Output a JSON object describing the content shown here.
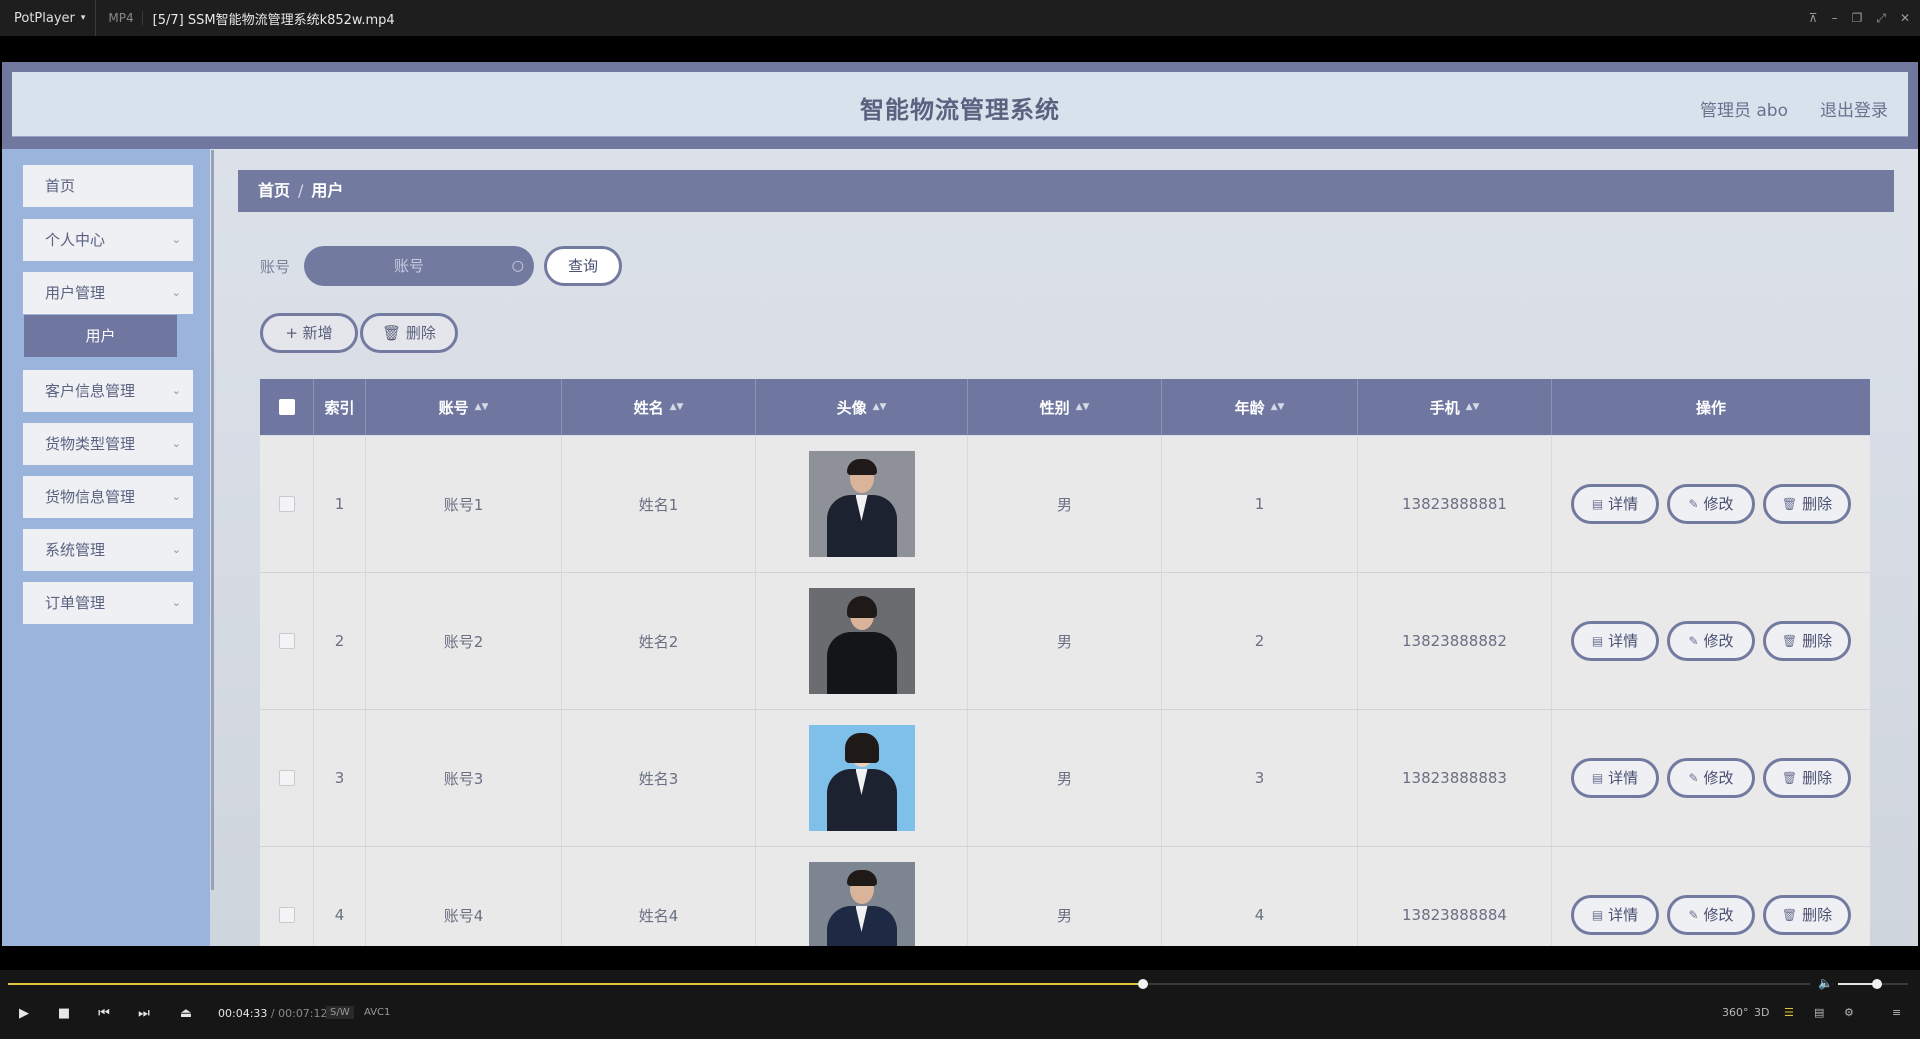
{
  "player": {
    "app_name": "PotPlayer",
    "format": "MP4",
    "file_title": "[5/7] SSM智能物流管理系统k852w.mp4",
    "current_time": "00:04:33",
    "total_time": "00:07:12",
    "badge_sw": "S/W",
    "badge_codec": "AVC1",
    "label_360": "360°",
    "label_3d": "3D",
    "progress_fraction": 0.63,
    "volume_fraction": 0.55,
    "accent_color": "#e2c43a"
  },
  "app": {
    "title": "智能物流管理系统",
    "admin_label": "管理员 abo",
    "logout_label": "退出登录",
    "primary_color": "#6f77a0",
    "sidebar_color": "#9bb4dc"
  },
  "sidebar": {
    "items": [
      {
        "label": "首页",
        "has_children": false
      },
      {
        "label": "个人中心",
        "has_children": true
      },
      {
        "label": "用户管理",
        "has_children": true
      },
      {
        "label": "客户信息管理",
        "has_children": true
      },
      {
        "label": "货物类型管理",
        "has_children": true
      },
      {
        "label": "货物信息管理",
        "has_children": true
      },
      {
        "label": "系统管理",
        "has_children": true
      },
      {
        "label": "订单管理",
        "has_children": true
      }
    ],
    "active_sub": "用户"
  },
  "breadcrumb": {
    "home": "首页",
    "separator": "/",
    "current": "用户"
  },
  "search": {
    "label": "账号",
    "placeholder": "账号",
    "value": "",
    "query_label": "查询"
  },
  "actions": {
    "add_label": "新增",
    "delete_label": "删除"
  },
  "table": {
    "columns": [
      "索引",
      "账号",
      "姓名",
      "头像",
      "性别",
      "年龄",
      "手机",
      "操作"
    ],
    "rows": [
      {
        "index": "1",
        "account": "账号1",
        "name": "姓名1",
        "gender": "男",
        "age": "1",
        "phone": "13823888881",
        "photo": "man-grey-background"
      },
      {
        "index": "2",
        "account": "账号2",
        "name": "姓名2",
        "gender": "男",
        "age": "2",
        "phone": "13823888882",
        "photo": "woman-grey-background"
      },
      {
        "index": "3",
        "account": "账号3",
        "name": "姓名3",
        "gender": "男",
        "age": "3",
        "phone": "13823888883",
        "photo": "woman-blue-background"
      },
      {
        "index": "4",
        "account": "账号4",
        "name": "姓名4",
        "gender": "男",
        "age": "4",
        "phone": "13823888884",
        "photo": "man-grey-background"
      }
    ],
    "row_actions": {
      "detail": "详情",
      "edit": "修改",
      "delete": "删除"
    }
  }
}
